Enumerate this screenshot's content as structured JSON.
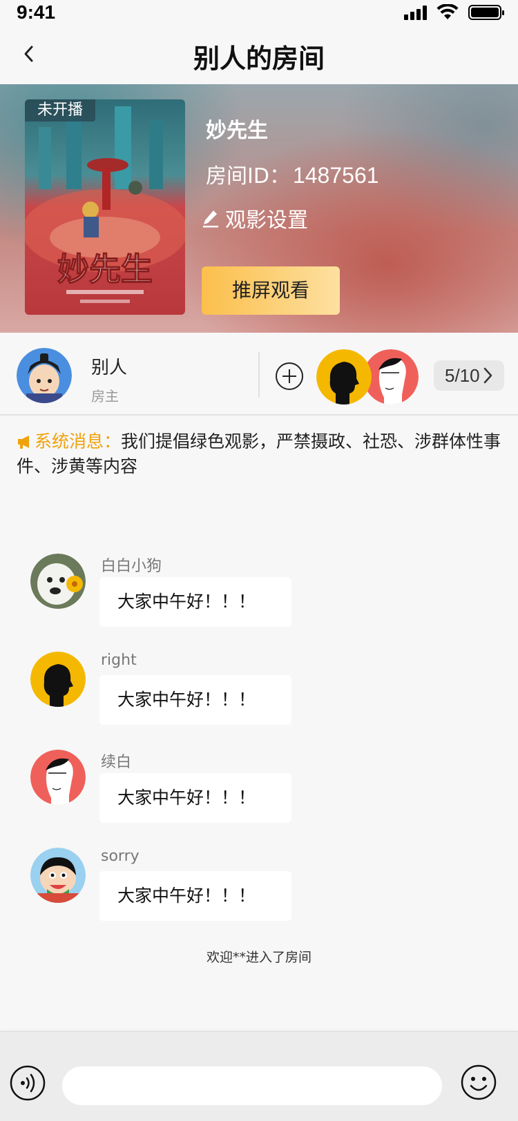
{
  "status_bar": {
    "time": "9:41"
  },
  "nav": {
    "title": "别人的房间"
  },
  "room": {
    "status_badge": "未开播",
    "name": "妙先生",
    "id_label": "房间ID：",
    "id_value": "1487561",
    "settings_label": "观影设置",
    "cast_button": "推屏观看",
    "poster_title": "妙先生"
  },
  "host": {
    "name": "别人",
    "role": "房主"
  },
  "members": {
    "count": "5/10"
  },
  "system_message": {
    "label": "系统消息：",
    "text": "我们提倡绿色观影，严禁摄政、社恐、涉群体性事件、涉黄等内容"
  },
  "chat": [
    {
      "user": "白白小狗",
      "text": "大家中午好！！！"
    },
    {
      "user": "right",
      "text": "大家中午好！！！"
    },
    {
      "user": "续白",
      "text": "大家中午好！！！"
    },
    {
      "user": "sorry",
      "text": "大家中午好！！！"
    }
  ],
  "welcome": "欢迎**进入了房间",
  "input": {
    "placeholder": ""
  },
  "colors": {
    "accent": "#f0a20a",
    "cast_button_start": "#fbbf4c",
    "cast_button_end": "#fde0a0"
  }
}
